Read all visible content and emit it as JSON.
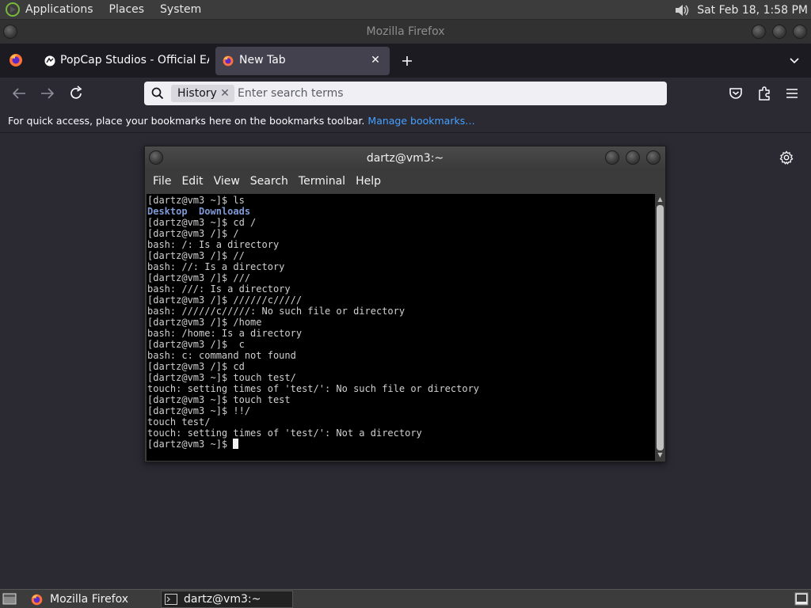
{
  "top_panel": {
    "menus": [
      "Applications",
      "Places",
      "System"
    ],
    "clock": "Sat Feb 18,  1:58 PM"
  },
  "firefox": {
    "window_title": "Mozilla Firefox",
    "tabs": [
      {
        "label": "PopCap Studios - Official EA"
      },
      {
        "label": "New Tab"
      }
    ],
    "urlbar": {
      "chip": "History",
      "placeholder": "Enter search terms"
    },
    "bookmarks_bar": {
      "text": "For quick access, place your bookmarks here on the bookmarks toolbar.",
      "link": "Manage bookmarks…"
    }
  },
  "terminal": {
    "title": "dartz@vm3:~",
    "menu": [
      "File",
      "Edit",
      "View",
      "Search",
      "Terminal",
      "Help"
    ],
    "lines": [
      "[dartz@vm3 ~]$ ls",
      "Desktop  Downloads",
      "[dartz@vm3 ~]$ cd /",
      "[dartz@vm3 /]$ /",
      "bash: /: Is a directory",
      "[dartz@vm3 /]$ //",
      "bash: //: Is a directory",
      "[dartz@vm3 /]$ ///",
      "bash: ///: Is a directory",
      "[dartz@vm3 /]$ //////c/////",
      "bash: //////c/////: No such file or directory",
      "[dartz@vm3 /]$ /home",
      "bash: /home: Is a directory",
      "[dartz@vm3 /]$  c",
      "bash: c: command not found",
      "[dartz@vm3 /]$ cd",
      "[dartz@vm3 ~]$ touch test/",
      "touch: setting times of 'test/': No such file or directory",
      "[dartz@vm3 ~]$ touch test",
      "[dartz@vm3 ~]$ !!/",
      "touch test/",
      "touch: setting times of 'test/': Not a directory",
      "[dartz@vm3 ~]$ "
    ],
    "ls_dirs": [
      "Desktop",
      "Downloads"
    ]
  },
  "taskbar": {
    "items": [
      {
        "label": "Mozilla Firefox"
      },
      {
        "label": "dartz@vm3:~"
      }
    ]
  }
}
